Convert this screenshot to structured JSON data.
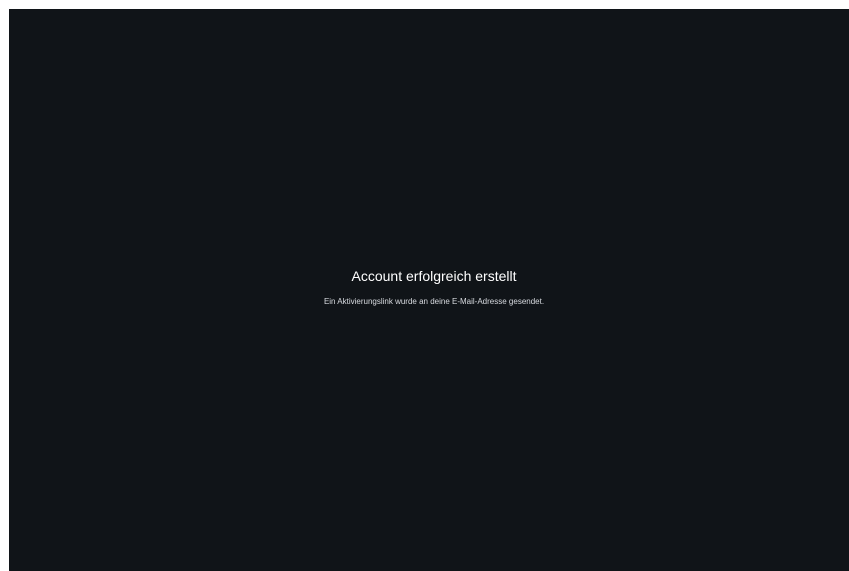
{
  "colors": {
    "background": "#101418",
    "title": "#ffffff",
    "subtitle": "#d8dbe0"
  },
  "status": {
    "title": "Account erfolgreich erstellt",
    "message": "Ein Aktivierungslink wurde an deine E-Mail-Adresse gesendet."
  }
}
